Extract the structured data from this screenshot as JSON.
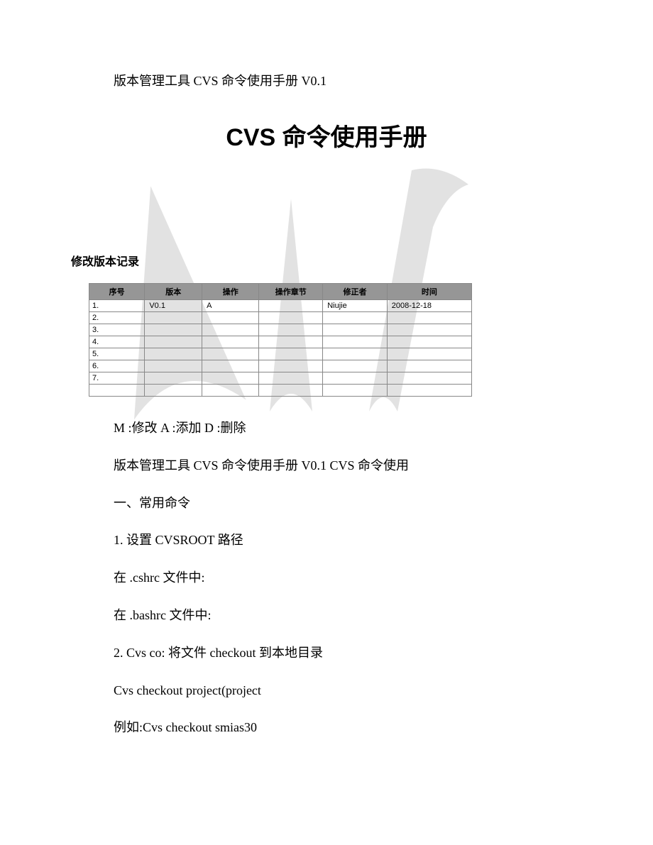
{
  "header": "版本管理工具 CVS 命令使用手册 V0.1",
  "main_title": "CVS 命令使用手册",
  "section_label": "修改版本记录",
  "table": {
    "headers": [
      "序号",
      "版本",
      "操作",
      "操作章节",
      "修正者",
      "时间"
    ],
    "rows": [
      {
        "idx": "1.",
        "ver": "V0.1",
        "op": "A",
        "sect": "",
        "auth": "Niujie",
        "time": "2008-12-18"
      },
      {
        "idx": "2.",
        "ver": "",
        "op": "",
        "sect": "",
        "auth": "",
        "time": ""
      },
      {
        "idx": "3.",
        "ver": "",
        "op": "",
        "sect": "",
        "auth": "",
        "time": ""
      },
      {
        "idx": "4.",
        "ver": "",
        "op": "",
        "sect": "",
        "auth": "",
        "time": ""
      },
      {
        "idx": "5.",
        "ver": "",
        "op": "",
        "sect": "",
        "auth": "",
        "time": ""
      },
      {
        "idx": "6.",
        "ver": "",
        "op": "",
        "sect": "",
        "auth": "",
        "time": ""
      },
      {
        "idx": "7.",
        "ver": "",
        "op": "",
        "sect": "",
        "auth": "",
        "time": ""
      },
      {
        "idx": "",
        "ver": "",
        "op": "",
        "sect": "",
        "auth": "",
        "time": ""
      }
    ]
  },
  "paragraphs": [
    "M :修改 A :添加 D :删除",
    "版本管理工具 CVS 命令使用手册 V0.1 CVS 命令使用",
    "一、常用命令",
    "1. 设置 CVSROOT 路径",
    "在 .cshrc 文件中:",
    "在 .bashrc 文件中:",
    "2. Cvs co: 将文件 checkout 到本地目录",
    "Cvs checkout project(project",
    "例如:Cvs checkout smias30"
  ]
}
